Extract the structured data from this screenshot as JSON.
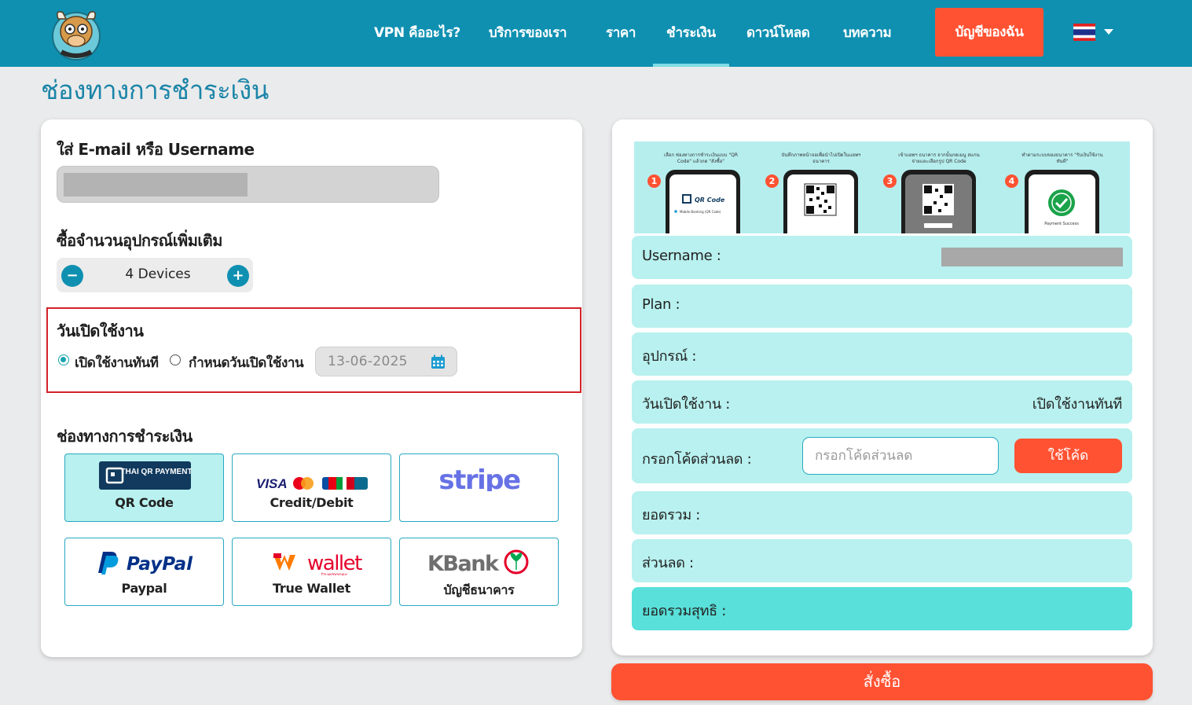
{
  "nav": {
    "items": [
      "VPN คืออะไร?",
      "บริการของเรา",
      "ราคา",
      "ชำระเงิน",
      "ดาวน์โหลด",
      "บทความ"
    ],
    "active": "ชำระเงิน",
    "account_button": "บัญชีของฉัน",
    "language": "th"
  },
  "page": {
    "title": "ช่องทางการชำระเงิน"
  },
  "form": {
    "email_label": "ใส่ E-mail หรือ Username",
    "devices_label": "ซื้อจำนวนอุปกรณ์เพิ่มเติม",
    "devices_value": "4 Devices",
    "activation_label": "วันเปิดใช้งาน",
    "activation_now": "เปิดใช้งานทันที",
    "activation_schedule": "กำหนดวันเปิดใช้งาน",
    "activation_selected": "now",
    "date_value": "13-06-2025",
    "payment_label": "ช่องทางการชำระเงิน",
    "payment_methods": [
      {
        "name": "QR Code",
        "logo_text": "THAI QR PAYMENT",
        "selected": true
      },
      {
        "name": "Credit/Debit",
        "logo_text": "VISA",
        "selected": false
      },
      {
        "name": "",
        "logo_text": "stripe",
        "selected": false
      },
      {
        "name": "Paypal",
        "logo_text": "PayPal",
        "selected": false
      },
      {
        "name": "True Wallet",
        "logo_text": "wallet",
        "logo_sub": "truemoney",
        "selected": false
      },
      {
        "name": "บัญชีธนาคาร",
        "logo_text": "KBank",
        "selected": false
      }
    ]
  },
  "summary": {
    "banner_steps": [
      {
        "num": "1",
        "screen_text": "QR Code",
        "screen_sub": "Mobile Banking (QR Code)",
        "caption": "เลือก ช่องทางการชำระเงินแบบ \"QR Code\" แล้วกด \"สั่งซื้อ\""
      },
      {
        "num": "2",
        "caption": "บันทึกภาพหน้าจอเพื่อนำไปเปิดในแอพฯ ธนาคาร"
      },
      {
        "num": "3",
        "caption": "เข้าแอพฯ ธนาคาร จากนั้นกดเมนู สแกนจ่ายและเลือกรูป QR Code"
      },
      {
        "num": "4",
        "screen_text": "Payment Success",
        "caption": "ทำตามระบบของธนาคาร \"รับเงินใช้งานทันที\""
      }
    ],
    "username_label": "Username :",
    "plan_label": "Plan :",
    "device_label": "อุปกรณ์ :",
    "activation_label": "วันเปิดใช้งาน :",
    "activation_value": "เปิดใช้งานทันที",
    "promo_label": "กรอกโค้ดส่วนลด :",
    "promo_placeholder": "กรอกโค้ดส่วนลด",
    "promo_button": "ใช้โค้ด",
    "subtotal_label": "ยอดรวม :",
    "discount_label": "ส่วนลด :",
    "total_label": "ยอดรวมสุทธิ :",
    "order_button": "สั่งซื้อ"
  },
  "colors": {
    "nav_bg": "#0f90b1",
    "accent": "#ff5232",
    "row_bg": "#b8f1ef",
    "total_bg": "#59e0da",
    "title": "#1b85a8"
  }
}
